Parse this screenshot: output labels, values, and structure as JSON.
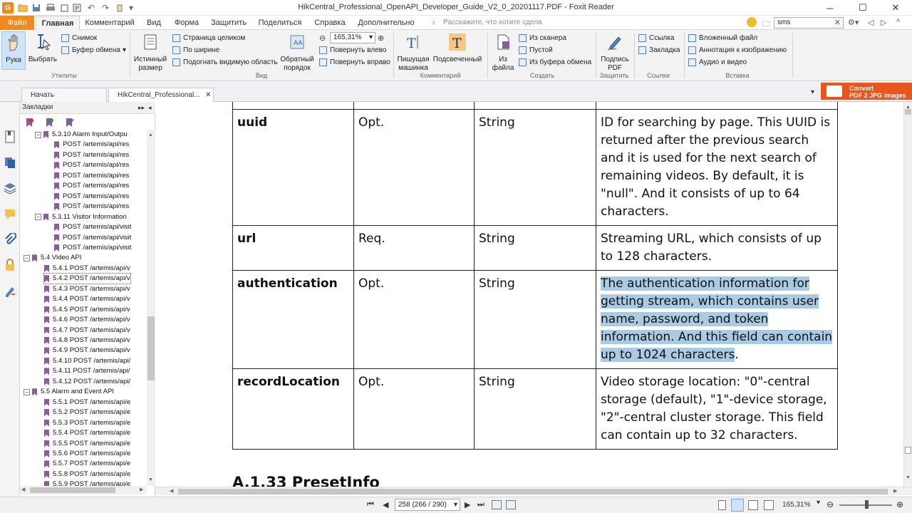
{
  "window": {
    "title": "HikCentral_Professional_OpenAPI_Developer_Guide_V2_0_20201117.PDF - Foxit Reader"
  },
  "menu": {
    "items": [
      "Файл",
      "Главная",
      "Комментарий",
      "Вид",
      "Форма",
      "Защитить",
      "Поделиться",
      "Справка",
      "Дополнительно"
    ],
    "tell_me_placeholder": "Расскажите, что хотите сдела",
    "search_value": "sms"
  },
  "ribbon": {
    "hand": "Рука",
    "select": "Выбрать",
    "snapshot": "Снимок",
    "clipboard": "Буфер обмена",
    "group_utilities": "Утилиты",
    "actual_size": "Истинный размер",
    "fit_page": "Страница целиком",
    "fit_width": "По ширине",
    "fit_visible": "Подогнать видимую область",
    "reverse_order": "Обратный порядок",
    "zoom_value": "165,31%",
    "rotate_left": "Повернуть влево",
    "rotate_right": "Повернуть вправо",
    "group_view": "Вид",
    "typewriter": "Пишущая машинка",
    "highlight": "Подсвеченный",
    "group_comment": "Комментарий",
    "from_file": "Из файла",
    "from_scanner": "Из сканера",
    "blank": "Пустой",
    "from_clipboard": "Из буфера обмена",
    "group_create": "Создать",
    "sign_pdf": "Подпись PDF",
    "group_protect": "Защитить",
    "link": "Ссылка",
    "bookmark": "Закладка",
    "group_links": "Ссылки",
    "attached_file": "Вложенный файл",
    "image_annotation": "Аннотация к изображению",
    "audio_video": "Аудио и видео",
    "group_insert": "Вставка"
  },
  "tabs": {
    "start": "Начать",
    "doc": "HikCentral_Professional...",
    "convert_line1": "Convert",
    "convert_line2": "PDF 2 JPG Images"
  },
  "bookmarks": {
    "header": "Закладки",
    "items": [
      {
        "label": "5.3.10 Alarm Input/Outpu",
        "level": 1,
        "toggle": "−"
      },
      {
        "label": "POST /artemis/api/res",
        "level": 2
      },
      {
        "label": "POST /artemis/api/res",
        "level": 2
      },
      {
        "label": "POST /artemis/api/res",
        "level": 2
      },
      {
        "label": "POST /artemis/api/res",
        "level": 2
      },
      {
        "label": "POST /artemis/api/res",
        "level": 2
      },
      {
        "label": "POST /artemis/api/res",
        "level": 2
      },
      {
        "label": "POST /artemis/api/res",
        "level": 2
      },
      {
        "label": "5.3.11 Visitor Information",
        "level": 1,
        "toggle": "−"
      },
      {
        "label": "POST /artemis/api/visit",
        "level": 2
      },
      {
        "label": "POST /artemis/api/visit",
        "level": 2
      },
      {
        "label": "POST /artemis/api/visit",
        "level": 2
      },
      {
        "label": "5.4 Video API",
        "level": 0,
        "toggle": "−"
      },
      {
        "label": "5.4.1 POST /artemis/api/v",
        "level": 1
      },
      {
        "label": "5.4.2 POST /artemis/api/v",
        "level": 1,
        "selected": true
      },
      {
        "label": "5.4.3 POST /artemis/api/v",
        "level": 1
      },
      {
        "label": "5.4.4 POST /artemis/api/v",
        "level": 1
      },
      {
        "label": "5.4.5 POST /artemis/api/v",
        "level": 1
      },
      {
        "label": "5.4.6 POST /artemis/api/v",
        "level": 1
      },
      {
        "label": "5.4.7 POST /artemis/api/v",
        "level": 1
      },
      {
        "label": "5.4.8 POST /artemis/api/v",
        "level": 1
      },
      {
        "label": "5.4.9 POST /artemis/api/v",
        "level": 1
      },
      {
        "label": "5.4.10 POST /artemis/api/",
        "level": 1
      },
      {
        "label": "5.4.11 POST /artemis/api/",
        "level": 1
      },
      {
        "label": "5.4.12 POST /artemis/api/",
        "level": 1
      },
      {
        "label": "5.5 Alarm and Event API",
        "level": 0,
        "toggle": "−"
      },
      {
        "label": "5.5.1 POST /artemis/api/e",
        "level": 1
      },
      {
        "label": "5.5.2 POST /artemis/api/e",
        "level": 1
      },
      {
        "label": "5.5.3 POST /artemis/api/e",
        "level": 1
      },
      {
        "label": "5.5.4 POST /artemis/api/e",
        "level": 1
      },
      {
        "label": "5.5.5 POST /artemis/api/e",
        "level": 1
      },
      {
        "label": "5.5.6 POST /artemis/api/e",
        "level": 1
      },
      {
        "label": "5.5.7 POST /artemis/api/e",
        "level": 1
      },
      {
        "label": "5.5.8 POST /artemis/api/e",
        "level": 1
      },
      {
        "label": "5.5.9 POST /artemis/api/e",
        "level": 1
      }
    ]
  },
  "document": {
    "rows": [
      {
        "name": "uuid",
        "req": "Opt.",
        "type": "String",
        "desc": "ID for searching by page. This UUID is returned after the previous search and it is used for the next search of remaining videos. By default, it is \"null\". And it consists of up to 64 characters."
      },
      {
        "name": "url",
        "req": "Req.",
        "type": "String",
        "desc": "Streaming URL, which consists of up to 128 characters."
      },
      {
        "name": "authentication",
        "req": "Opt.",
        "type": "String",
        "desc_highlighted": "The authentication information for getting stream, which contains user name, password, and token information. And this field can contain up to 1024 characters",
        "desc_tail": "."
      },
      {
        "name": "recordLocation",
        "req": "Opt.",
        "type": "String",
        "desc": "Video storage location: \"0\"-central storage (default), \"1\"-device storage, \"2\"-central cluster storage. This field can contain up to 32 characters."
      }
    ],
    "next_heading": "A.1.33 PresetInfo"
  },
  "status": {
    "page_value": "258 (266 / 290)",
    "zoom": "165,31%"
  }
}
